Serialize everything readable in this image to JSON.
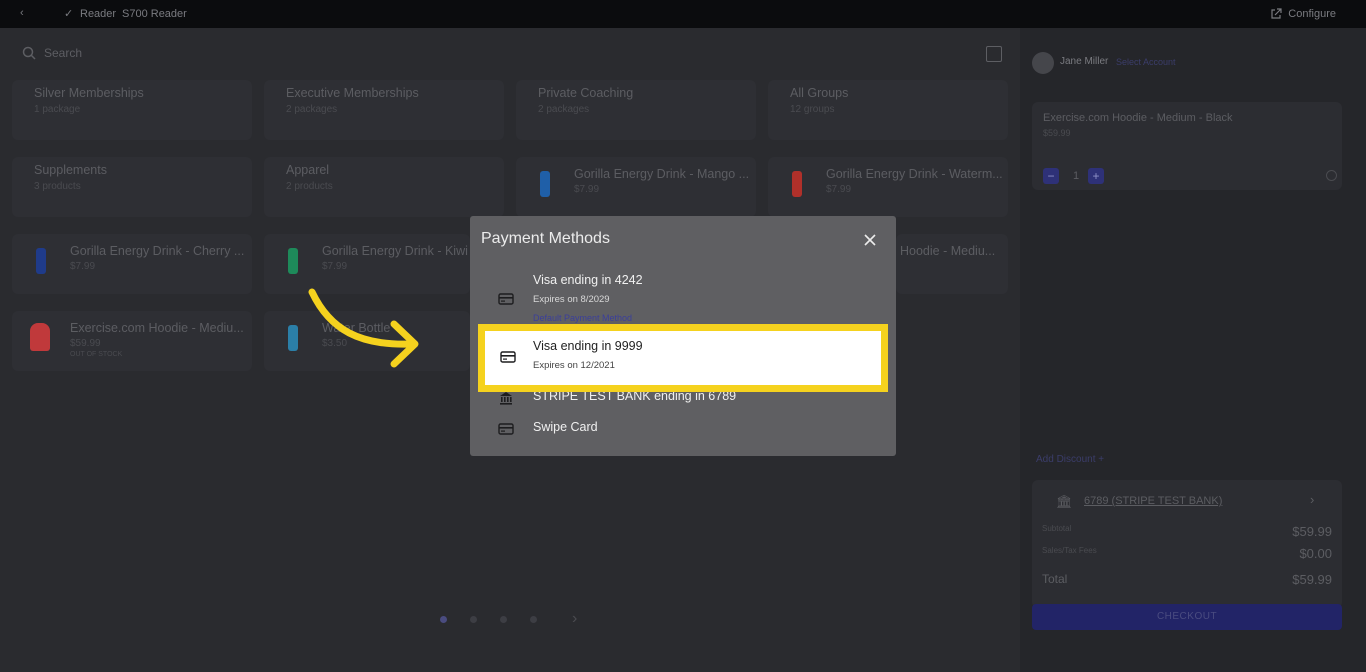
{
  "topbar": {
    "back_label": "‹",
    "reader_label": "Reader",
    "model_label": "S700 Reader",
    "configure_label": "Configure"
  },
  "search": {
    "placeholder": "Search"
  },
  "categories": [
    {
      "name": "Silver Memberships",
      "sub": "1 package"
    },
    {
      "name": "Executive Memberships",
      "sub": "2 packages"
    },
    {
      "name": "Private Coaching",
      "sub": "2 packages"
    },
    {
      "name": "All Groups",
      "sub": "12 groups"
    },
    {
      "name": "Supplements",
      "sub": "3 products"
    },
    {
      "name": "Apparel",
      "sub": "2 products"
    }
  ],
  "products": [
    {
      "name": "Gorilla Energy Drink - Mango ...",
      "price": "$7.99",
      "color": "#1f5fa8"
    },
    {
      "name": "Gorilla Energy Drink - Waterm...",
      "price": "$7.99",
      "color": "#b0302a"
    },
    {
      "name": "Gorilla Energy Drink - Cherry ...",
      "price": "$7.99",
      "color": "#1f3b8a"
    },
    {
      "name": "Gorilla Energy Drink - Kiwi S",
      "price": "$7.99",
      "color": "#1e8a5a"
    },
    {
      "name": "Hoodie - Mediu...",
      "price": "",
      "color": "#2e2f34"
    },
    {
      "name": "Exercise.com Hoodie - Mediu...",
      "price": "$59.99",
      "extra": "OUT OF STOCK",
      "color": "#c0393b"
    },
    {
      "name": "Water Bottle",
      "price": "$3.50",
      "color": "#2b7fa8"
    }
  ],
  "pagination": {
    "pages": 4,
    "active": 1
  },
  "right_panel": {
    "user_name": "Jane Miller",
    "select_account": "Select Account",
    "cart_item_name": "Exercise.com Hoodie - Medium - Black",
    "cart_item_price": "$59.99",
    "quantity": "1",
    "add_discount": "Add Discount",
    "payment_label": "6789 (STRIPE TEST BANK)",
    "subtotal_label": "Subtotal",
    "subtotal_value": "$59.99",
    "fees_label": "Sales/Tax Fees",
    "fees_value": "$0.00",
    "total_label": "Total",
    "total_value": "$59.99",
    "checkout_label": "CHECKOUT"
  },
  "modal": {
    "title": "Payment Methods",
    "methods": [
      {
        "title": "Visa ending in 4242",
        "sub": "Expires on 8/2029",
        "default": "Default Payment Method",
        "icon": "card-icon"
      },
      {
        "title": "Visa ending in 9999",
        "sub": "Expires on 12/2021",
        "icon": "card-icon"
      },
      {
        "title": "STRIPE TEST BANK ending in 6789",
        "icon": "bank-icon"
      },
      {
        "title": "Swipe Card",
        "icon": "card-icon"
      }
    ]
  },
  "colors": {
    "highlight": "#f5d21e",
    "accent": "#2e3178",
    "arrow": "#f5d21e"
  }
}
